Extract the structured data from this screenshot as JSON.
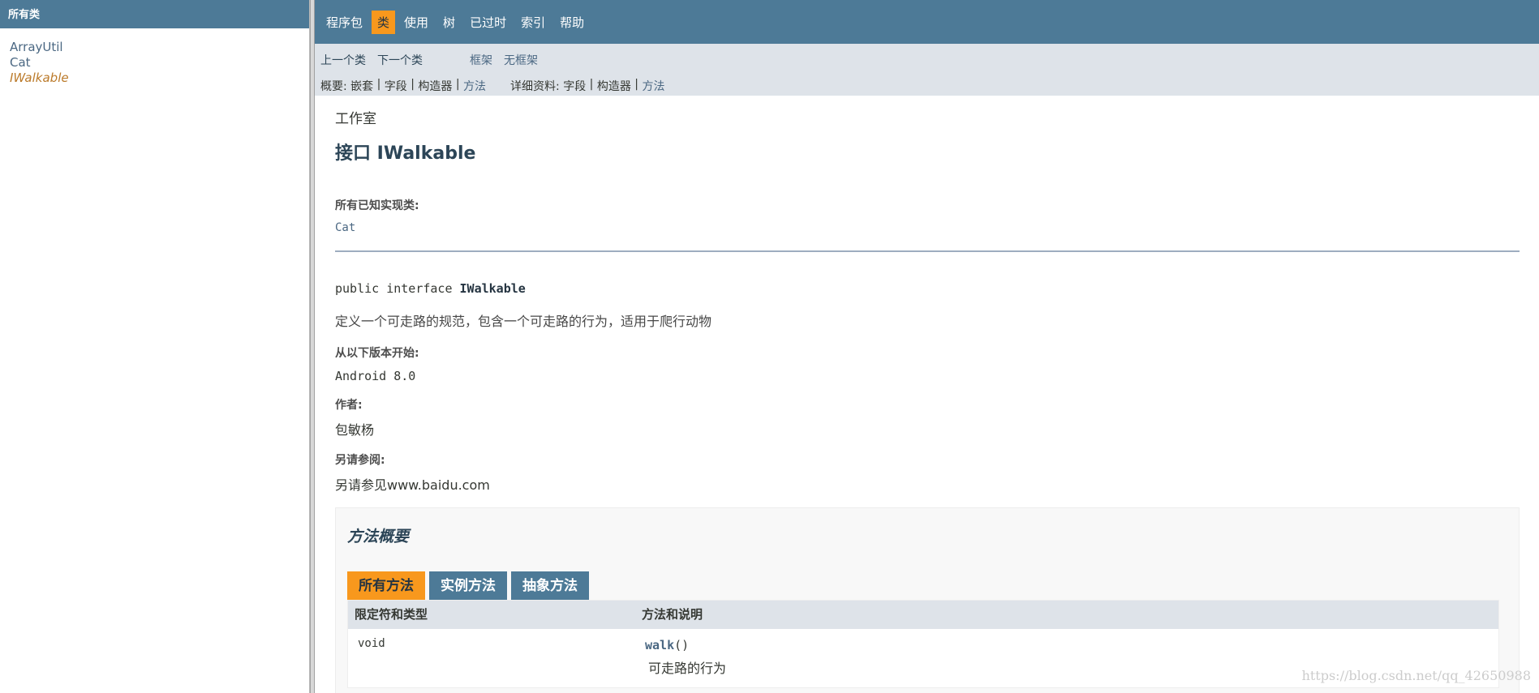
{
  "left_frame": {
    "header": "所有类",
    "classes": [
      "ArrayUtil",
      "Cat",
      "IWalkable"
    ]
  },
  "top_nav": {
    "items": [
      "程序包",
      "类",
      "使用",
      "树",
      "已过时",
      "索引",
      "帮助"
    ],
    "active": "类"
  },
  "sub_nav": {
    "prev_class": "上一个类",
    "next_class": "下一个类",
    "frames": "框架",
    "no_frames": "无框架",
    "summary_prefix": "概要: ",
    "summary_nested": "嵌套",
    "summary_field": "字段",
    "summary_ctor": "构造器",
    "summary_method": "方法",
    "detail_prefix": "详细资料: ",
    "detail_field": "字段",
    "detail_ctor": "构造器",
    "detail_method": "方法",
    "sep": " | "
  },
  "content": {
    "package": "工作室",
    "title": "接口 IWalkable",
    "impl_label": "所有已知实现类:",
    "impl_value": "Cat",
    "decl_prefix": "public interface ",
    "decl_name": "IWalkable",
    "description": "定义一个可走路的规范，包含一个可走路的行为，适用于爬行动物",
    "since_label": "从以下版本开始:",
    "since_value": "Android 8.0",
    "author_label": "作者:",
    "author_value": "包敏杨",
    "see_label": "另请参阅:",
    "see_value": "另请参见www.baidu.com"
  },
  "method_summary": {
    "title": "方法概要",
    "tabs": [
      "所有方法",
      "实例方法",
      "抽象方法"
    ],
    "col_modifier": "限定符和类型",
    "col_method": "方法和说明",
    "rows": [
      {
        "modifier": "void",
        "name": "walk",
        "params": "()",
        "description": "可走路的行为"
      }
    ]
  },
  "watermark": "https://blog.csdn.net/qq_42650988",
  "colors": {
    "nav_bg": "#4D7A97",
    "active_tab": "#F8981D",
    "subnav_bg": "#dee3e9",
    "link": "#4A6782"
  }
}
